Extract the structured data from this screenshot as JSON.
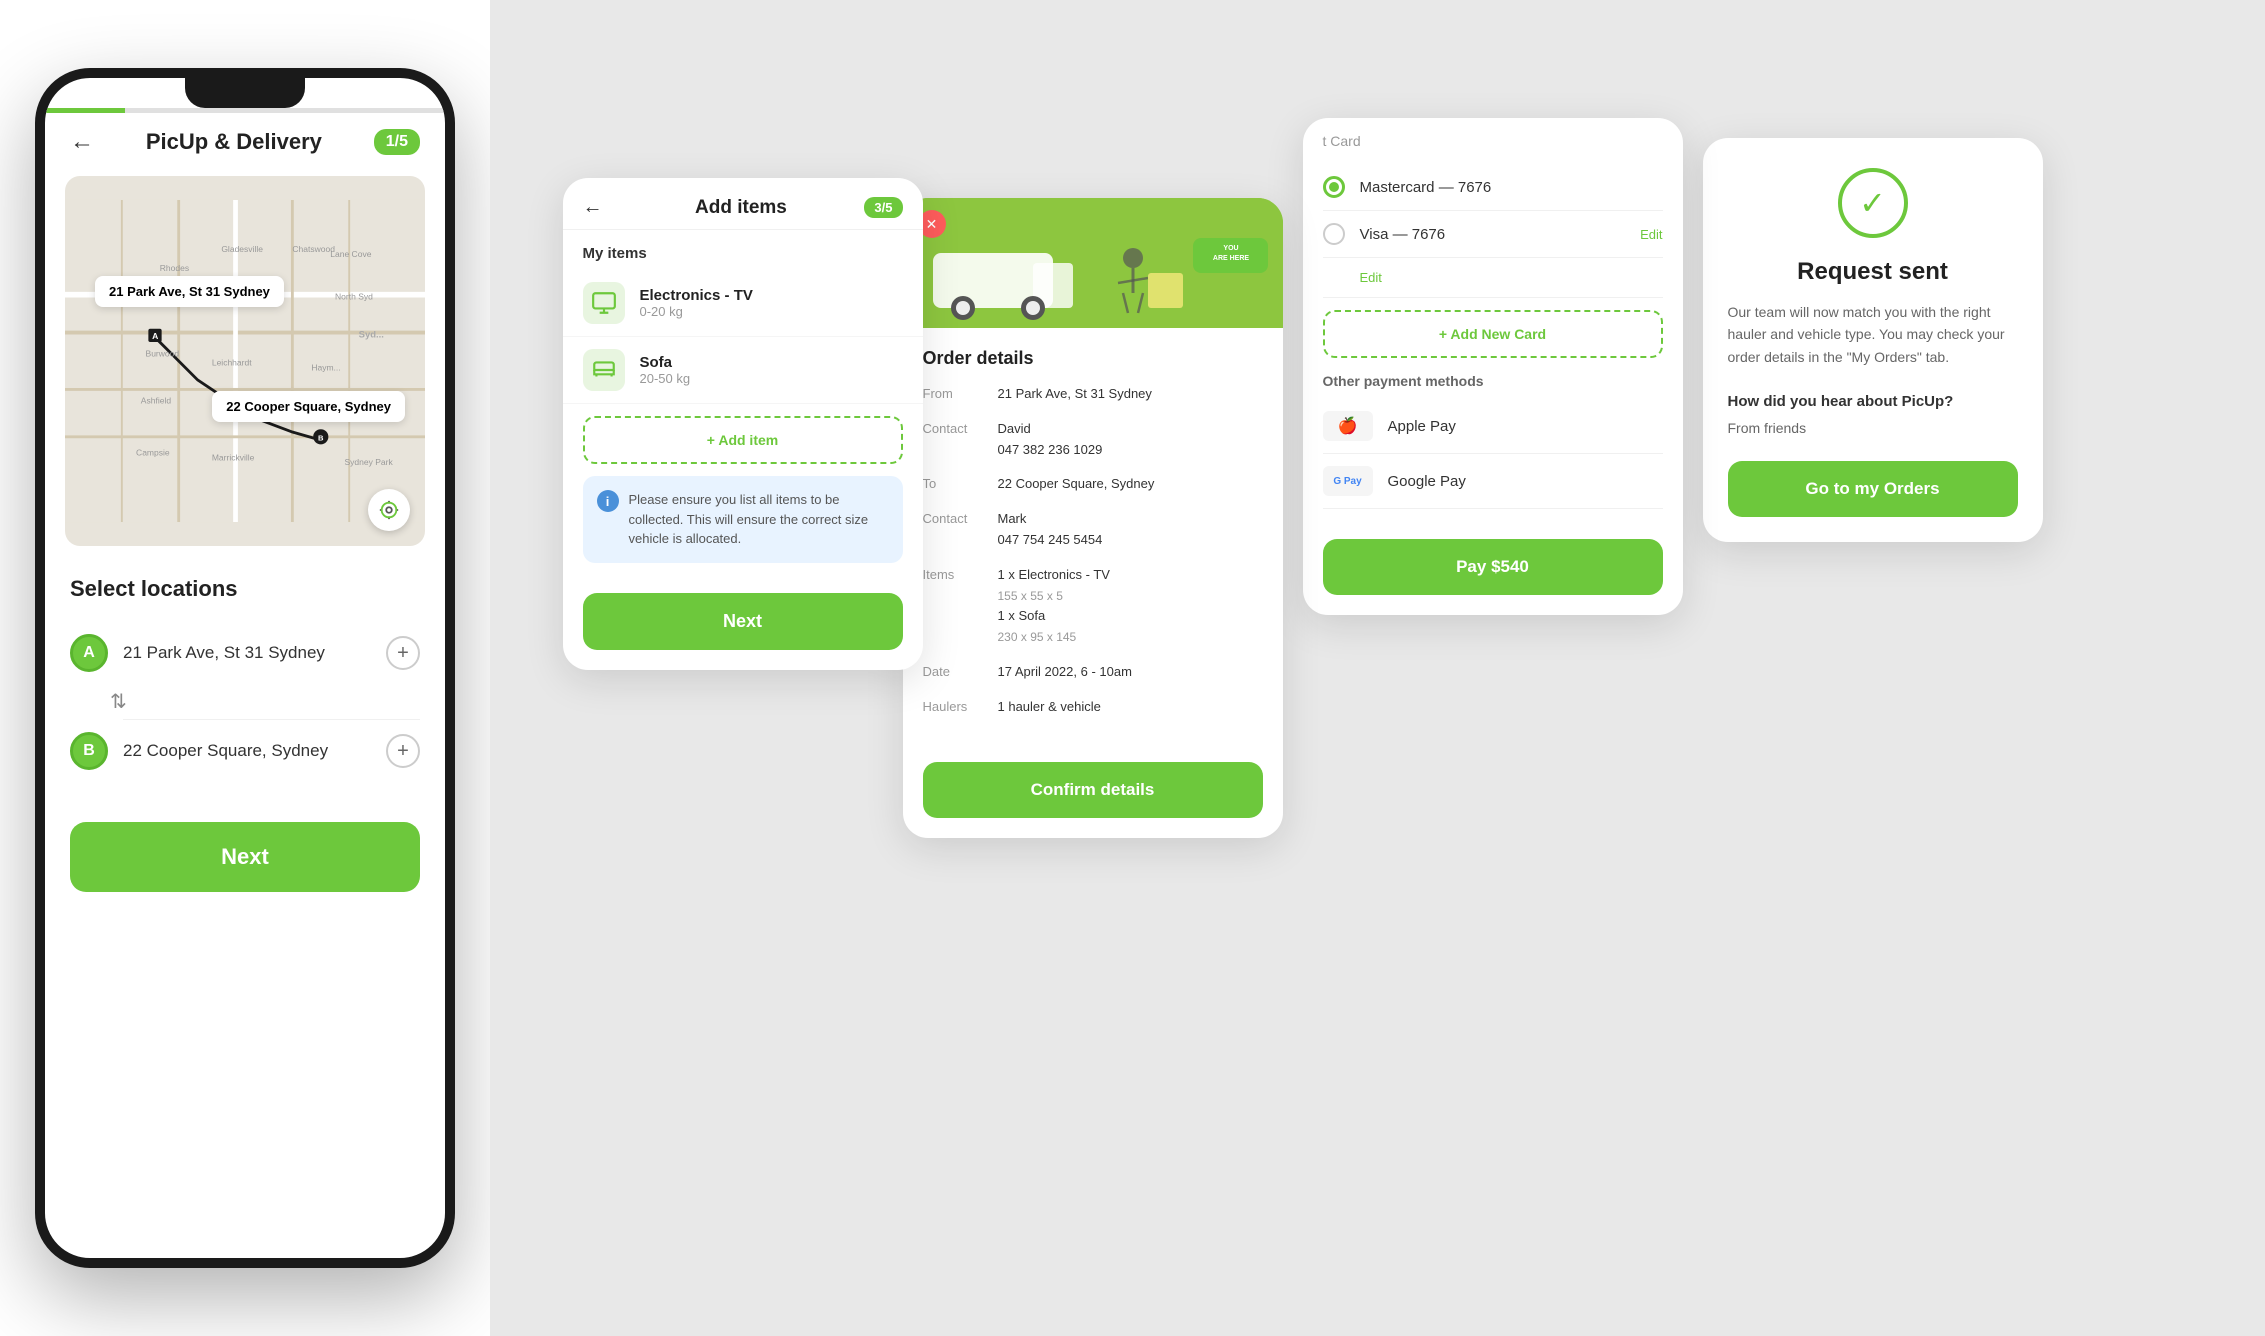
{
  "app": {
    "title": "PicUp & Delivery",
    "step": "1/5",
    "back_arrow": "←"
  },
  "phone": {
    "map": {
      "from_tooltip": "21 Park Ave, St 31 Sydney",
      "to_tooltip": "22 Cooper Square, Sydney",
      "gps_icon": "⊕"
    },
    "select_locations": {
      "title": "Select locations",
      "location_a": {
        "badge": "A",
        "address": "21 Park Ave, St 31 Sydney"
      },
      "location_b": {
        "badge": "B",
        "address": "22 Cooper Square, Sydney"
      },
      "add_label": "+",
      "swap_icon": "⇅"
    },
    "next_button": "Next"
  },
  "card_add_items": {
    "back": "←",
    "title": "Add items",
    "badge": "3/5",
    "my_items_label": "My items",
    "items": [
      {
        "name": "Electronics - TV",
        "weight": "0-20 kg",
        "icon": "📦"
      },
      {
        "name": "Sofa",
        "weight": "20-50 kg",
        "icon": "📦"
      }
    ],
    "add_item_label": "+ Add item",
    "info_text": "Please ensure you list all items to be collected. This will ensure the correct size vehicle is allocated.",
    "next_button": "Next"
  },
  "card_order_details": {
    "close_icon": "✕",
    "section_title": "Order details",
    "from_label": "From",
    "from_address": "21 Park Ave, St 31 Sydney",
    "contact_label": "Contact",
    "from_contact_name": "David",
    "from_contact_phone": "047 382 236 1029",
    "to_label": "To",
    "to_address": "22 Cooper Square, Sydney",
    "to_contact_label": "Contact",
    "to_contact_name": "Mark",
    "to_contact_phone": "047 754 245 5454",
    "items_label": "Items",
    "item1": "1 x Electronics - TV",
    "item1_dims": "155 x 55 x 5",
    "item2": "1 x Sofa",
    "item2_dims": "230 x 95 x 145",
    "date_label": "Date",
    "date_value": "17 April 2022, 6 - 10am",
    "haulers_label": "Haulers",
    "haulers_value": "1 hauler & vehicle",
    "confirm_button": "Confirm details"
  },
  "card_payment": {
    "section_title": "t Card",
    "mastercard": "Mastercard — 7676",
    "visa": "Visa — 7676",
    "edit_label": "Edit",
    "add_card_label": "+ Add New Card",
    "other_title": "Other payment methods",
    "apple_pay": "Apple Pay",
    "google_pay": "Google Pay",
    "pay_button": "Pay $540"
  },
  "card_request_sent": {
    "check_icon": "✓",
    "title": "Request sent",
    "description": "Our team will now match you with the right hauler and vehicle type. You may check your order details in the \"My Orders\" tab.",
    "hear_about_question": "How did you hear about PicUp?",
    "hear_about_answer": "From friends",
    "go_orders_button": "Go to my Orders"
  },
  "colors": {
    "green": "#6dc83c",
    "dark": "#222222",
    "gray_bg": "#e8e8e8",
    "info_blue": "#4a90d9"
  }
}
